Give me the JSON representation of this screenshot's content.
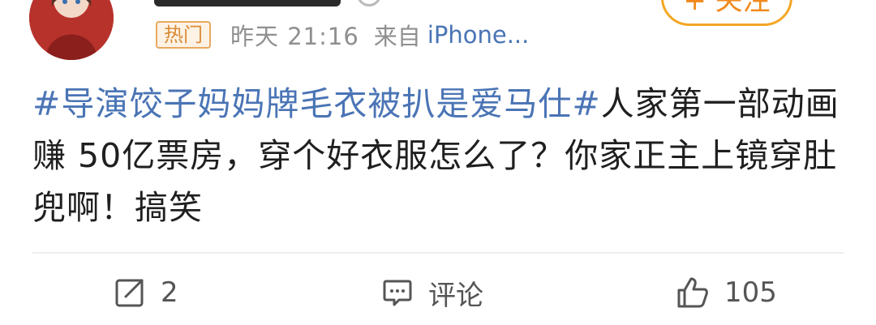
{
  "post": {
    "username": "",
    "follow_label": "+ 关注",
    "meta": {
      "hot_badge": "热门",
      "time": "昨天 21:16",
      "source_prefix": "来自",
      "source_device": "iPhone..."
    },
    "content": {
      "topic": "#导演饺子妈妈牌毛衣被扒是爱马仕#",
      "text": "人家第一部动画赚 50亿票房，穿个好衣服怎么了？你家正主上镜穿肚兜啊！搞笑"
    },
    "actions": {
      "repost_count": "2",
      "comment_label": "评论",
      "like_count": "105"
    }
  },
  "colors": {
    "link": "#4a74b5",
    "follow_accent": "#f5a623",
    "hot_badge": "#e8a860",
    "meta_gray": "#8f8f8f"
  },
  "icons": [
    "avatar",
    "verified-badge-icon",
    "repost-icon",
    "comment-icon",
    "like-thumb-icon"
  ]
}
